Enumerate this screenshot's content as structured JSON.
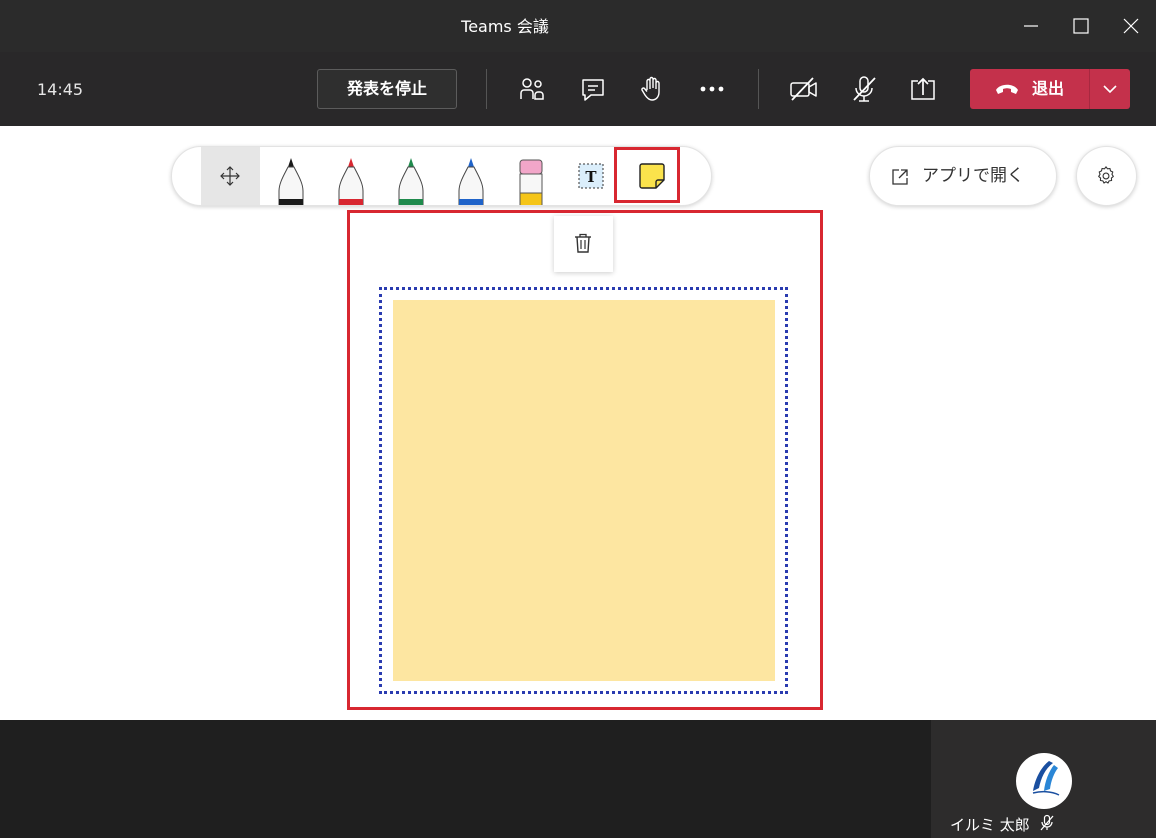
{
  "window": {
    "title": "Teams 会議"
  },
  "callbar": {
    "time": "14:45",
    "stop_presenting_label": "発表を停止",
    "leave_label": "退出"
  },
  "whiteboard": {
    "tools": [
      "move",
      "pen-black",
      "pen-red",
      "pen-green",
      "pen-blue",
      "eraser",
      "text-box",
      "sticky-note"
    ],
    "selected_tool": "sticky-note",
    "open_in_app_label": "アプリで開く",
    "sticky_note_color": "#fde6a1"
  },
  "participant": {
    "name": "イルミ 太郎"
  },
  "colors": {
    "leave_red": "#c4314b",
    "highlight_red": "#d82731",
    "selection_blue": "#2a3bb0"
  }
}
